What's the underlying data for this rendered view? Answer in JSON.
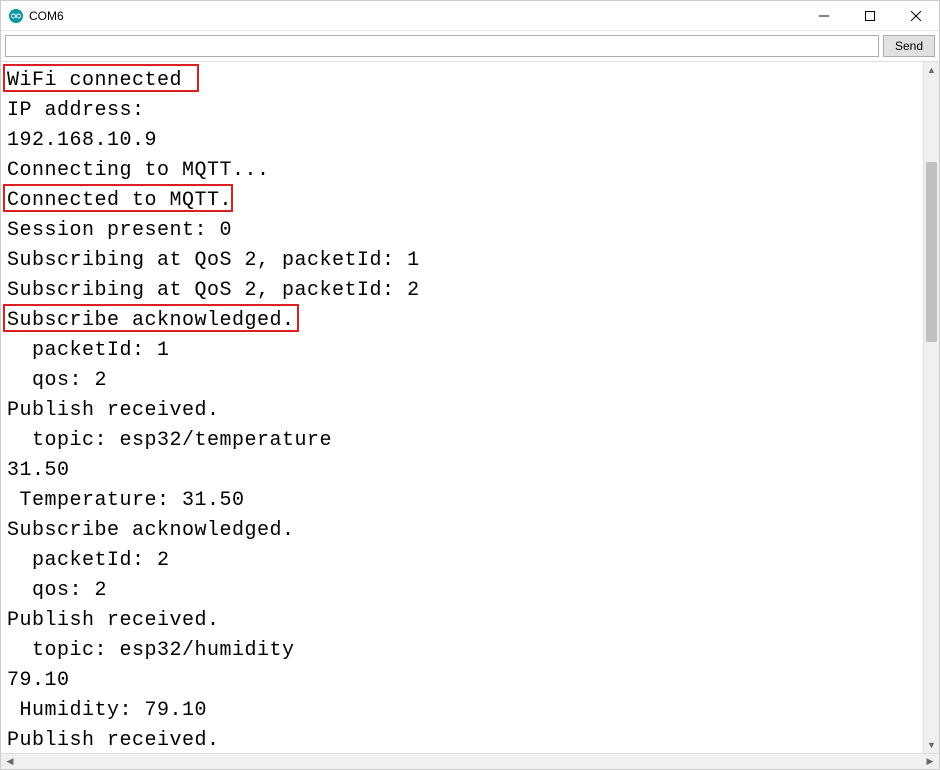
{
  "window": {
    "title": "COM6"
  },
  "controls": {
    "input_value": "",
    "input_placeholder": "",
    "send_label": "Send"
  },
  "output": {
    "lines": [
      "WiFi connected",
      "IP address:",
      "192.168.10.9",
      "Connecting to MQTT...",
      "Connected to MQTT.",
      "Session present: 0",
      "Subscribing at QoS 2, packetId: 1",
      "Subscribing at QoS 2, packetId: 2",
      "Subscribe acknowledged.",
      "  packetId: 1",
      "  qos: 2",
      "Publish received.",
      "  topic: esp32/temperature",
      "31.50",
      " Temperature: 31.50",
      "Subscribe acknowledged.",
      "  packetId: 2",
      "  qos: 2",
      "Publish received.",
      "  topic: esp32/humidity",
      "79.10",
      " Humidity: 79.10",
      "Publish received."
    ],
    "highlighted_lines": [
      0,
      4,
      8
    ]
  },
  "highlight_widths": {
    "0": 196,
    "4": 230,
    "8": 296
  }
}
